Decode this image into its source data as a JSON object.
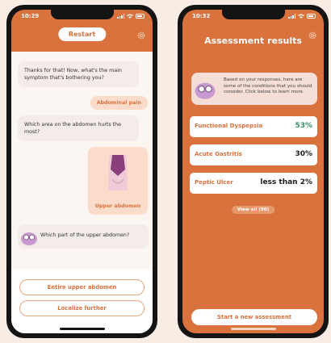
{
  "left_phone": {
    "status_time": "10:29",
    "restart_label": "Restart",
    "messages": {
      "bot_1": "Thanks for that! Now, what's the main symptom that's bothering you?",
      "user_1": "Abdominal pain",
      "bot_2": "Which area on the abdomen hurts the most?",
      "user_2": "Upper abdomen",
      "bot_3": "Which part of the upper abdomen?"
    },
    "answers": [
      "Entire upper abdomen",
      "Localize further"
    ]
  },
  "right_phone": {
    "status_time": "10:32",
    "title": "Assessment results",
    "intro": "Based on your responses, here are some of the conditions that you should consider. Click below to learn more.",
    "results": [
      {
        "name": "Functional Dyspepsia",
        "value": "53%"
      },
      {
        "name": "Acute Gastritis",
        "value": "30%"
      },
      {
        "name": "Peptic Ulcer",
        "value": "less than 2%"
      }
    ],
    "view_all_label": "View all (90)",
    "new_assessment_label": "Start a new assessment"
  },
  "colors": {
    "brand_orange": "#d9723d",
    "light_peach": "#fbdccb",
    "success_green": "#3a8f6a",
    "background": "#f8ece4"
  }
}
